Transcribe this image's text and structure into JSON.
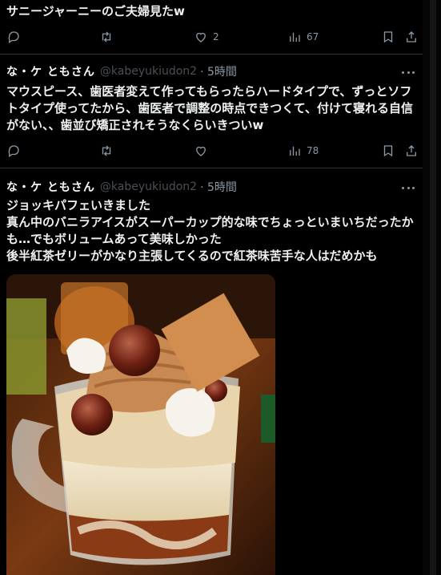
{
  "tweets": [
    {
      "text": "サニージャーニーのご夫婦見たw",
      "likes": "2",
      "views": "67"
    },
    {
      "author_name": "な・ケ ともさん",
      "handle": "@kabeyukiudon2",
      "time": "· 5時間",
      "text": "マウスピース、歯医者変えて作ってもらったらハードタイプで、ずっとソフトタイプ使ってたから、歯医者で調整の時点できつくて、付けて寝れる自信がない、、歯並び矯正されそうなくらいきついw",
      "likes": "",
      "views": "78"
    },
    {
      "author_name": "な・ケ ともさん",
      "handle": "@kabeyukiudon2",
      "time": "· 5時間",
      "text": "ジョッキパフェいきました\n真ん中のバニラアイスがスーパーカップ的な味でちょっといまいちだったかも…でもボリュームあって美味しかった\n後半紅茶ゼリーがかなり主張してくるので紅茶味苦手な人はだめかも"
    }
  ],
  "icons": {
    "reply": "reply-icon",
    "retweet": "retweet-icon",
    "like": "heart-icon",
    "views": "views-icon",
    "bookmark": "bookmark-icon",
    "share": "share-icon",
    "more": "more-icon"
  },
  "colors": {
    "background": "#000000",
    "text": "#e7e9ea",
    "muted": "#71767b",
    "divider": "#2f3336"
  }
}
